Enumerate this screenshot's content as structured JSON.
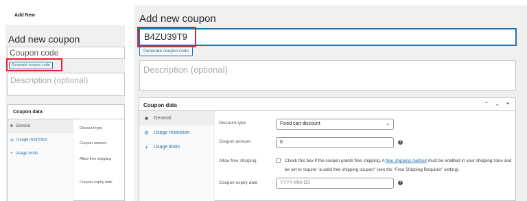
{
  "left_panel": {
    "top_label": "Add New",
    "heading": "Add new coupon",
    "coupon_code_placeholder": "Coupon code",
    "generate_button": "Generate coupon code",
    "description_placeholder": "Description (optional)",
    "coupon_data_title": "Coupon data",
    "tabs": [
      {
        "label": "General",
        "icon": "ticket-icon",
        "active": true
      },
      {
        "label": "Usage restriction",
        "icon": "restriction-icon",
        "active": false
      },
      {
        "label": "Usage limits",
        "icon": "plus-icon",
        "active": false
      }
    ],
    "field_labels": [
      "Discount type",
      "Coupon amount",
      "Allow free shipping",
      "Coupon expiry date"
    ]
  },
  "right_panel": {
    "heading": "Add new coupon",
    "coupon_code_value": "B4ZU39T9",
    "generate_button": "Generate coupon code",
    "description_placeholder": "Description (optional)",
    "coupon_data_title": "Coupon data",
    "header_icons": [
      "chevron-up-icon",
      "chevron-down-icon",
      "triangle-up-icon"
    ],
    "tabs": [
      {
        "label": "General",
        "icon": "ticket-icon",
        "active": true
      },
      {
        "label": "Usage restriction",
        "icon": "restriction-icon",
        "active": false
      },
      {
        "label": "Usage limits",
        "icon": "plus-icon",
        "active": false
      }
    ],
    "discount_type_label": "Discount type",
    "discount_type_value": "Fixed cart discount",
    "coupon_amount_label": "Coupon amount",
    "coupon_amount_value": "0",
    "free_shipping_label": "Allow free shipping",
    "free_shipping_text_before": "Check this box if the coupon grants free shipping. A ",
    "free_shipping_link": "free shipping method",
    "free_shipping_text_after": " must be enabled in your shipping zone and be set to require \"a valid free shipping coupon\" (see the \"Free Shipping Requires\" setting).",
    "expiry_label": "Coupon expiry date",
    "expiry_placeholder": "YYYY-MM-DD"
  },
  "colors": {
    "accent": "#2271b1",
    "highlight": "#e0222b",
    "background": "#f0f0f1"
  }
}
